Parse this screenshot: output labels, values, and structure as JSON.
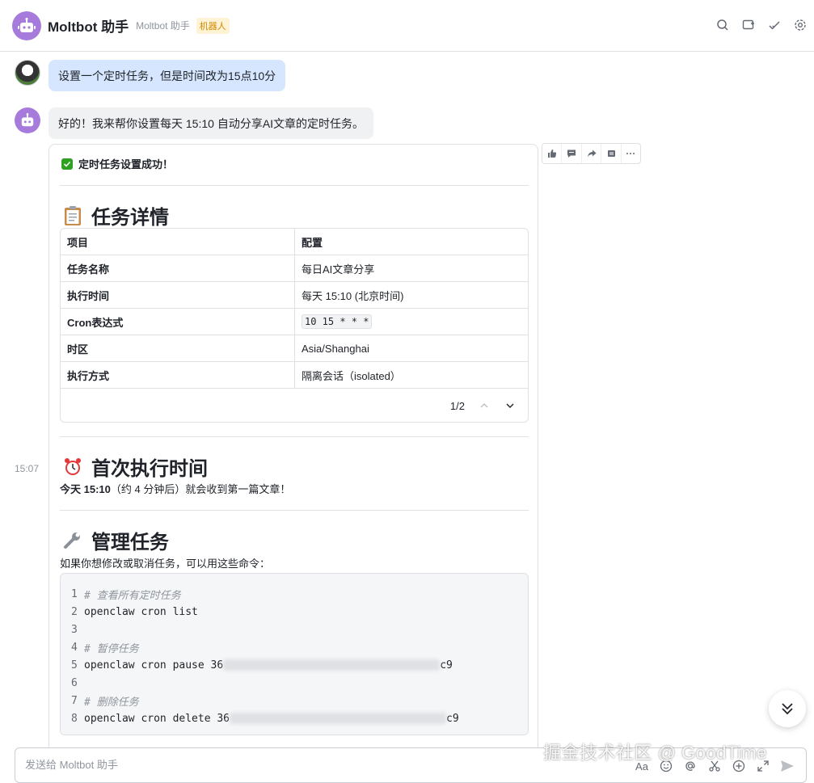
{
  "header": {
    "title": "Moltbot 助手",
    "subtitle": "Moltbot 助手",
    "badge": "机器人",
    "icons": [
      "search-icon",
      "add-window-icon",
      "checkmark-icon",
      "settings-icon"
    ]
  },
  "messages": {
    "user_text": "设置一个定时任务，但是时间改为15点10分",
    "bot_text": "好的！我来帮你设置每天 15:10 自动分享AI文章的定时任务。",
    "timestamp": "15:07"
  },
  "card": {
    "success": "定时任务设置成功！",
    "section1_title": "任务详情",
    "table": {
      "headers": [
        "项目",
        "配置"
      ],
      "rows": [
        [
          "任务名称",
          "每日AI文章分享"
        ],
        [
          "执行时间",
          "每天 15:10 (北京时间)"
        ],
        [
          "Cron表达式",
          "10 15 * * *"
        ],
        [
          "时区",
          "Asia/Shanghai"
        ],
        [
          "执行方式",
          "隔离会话（isolated）"
        ]
      ],
      "pager": "1/2"
    },
    "section2_title": "首次执行时间",
    "first_run_bold": "今天 15:10",
    "first_run_rest": "（约 4 分钟后）就会收到第一篇文章！",
    "section3_title": "管理任务",
    "manage_desc": "如果你想修改或取消任务，可以用这些命令：",
    "code_lines": [
      {
        "n": "1",
        "text": "# 查看所有定时任务",
        "comment": true
      },
      {
        "n": "2",
        "text": "openclaw cron list",
        "comment": false
      },
      {
        "n": "3",
        "text": "",
        "comment": false
      },
      {
        "n": "4",
        "text": "# 暂停任务",
        "comment": true
      },
      {
        "n": "5",
        "text": "openclaw cron pause 36",
        "suffix": "c9",
        "comment": false
      },
      {
        "n": "6",
        "text": "",
        "comment": false
      },
      {
        "n": "7",
        "text": "# 删除任务",
        "comment": true
      },
      {
        "n": "8",
        "text": "openclaw cron delete 36",
        "suffix": "c9",
        "comment": false
      }
    ]
  },
  "toolbar": {
    "icons": [
      "thumbs-up-icon",
      "comment-icon",
      "forward-icon",
      "quote-icon",
      "more-icon"
    ]
  },
  "input": {
    "placeholder": "发送给 Moltbot 助手",
    "font_button": "Aa"
  },
  "watermark": "掘金技术社区 @ GoodTime",
  "colors": {
    "user_bubble": "#d6e6fe",
    "bot_bubble": "#f0f1f3",
    "bot_avatar": "#a77bdb",
    "success_green": "#2ea121"
  }
}
